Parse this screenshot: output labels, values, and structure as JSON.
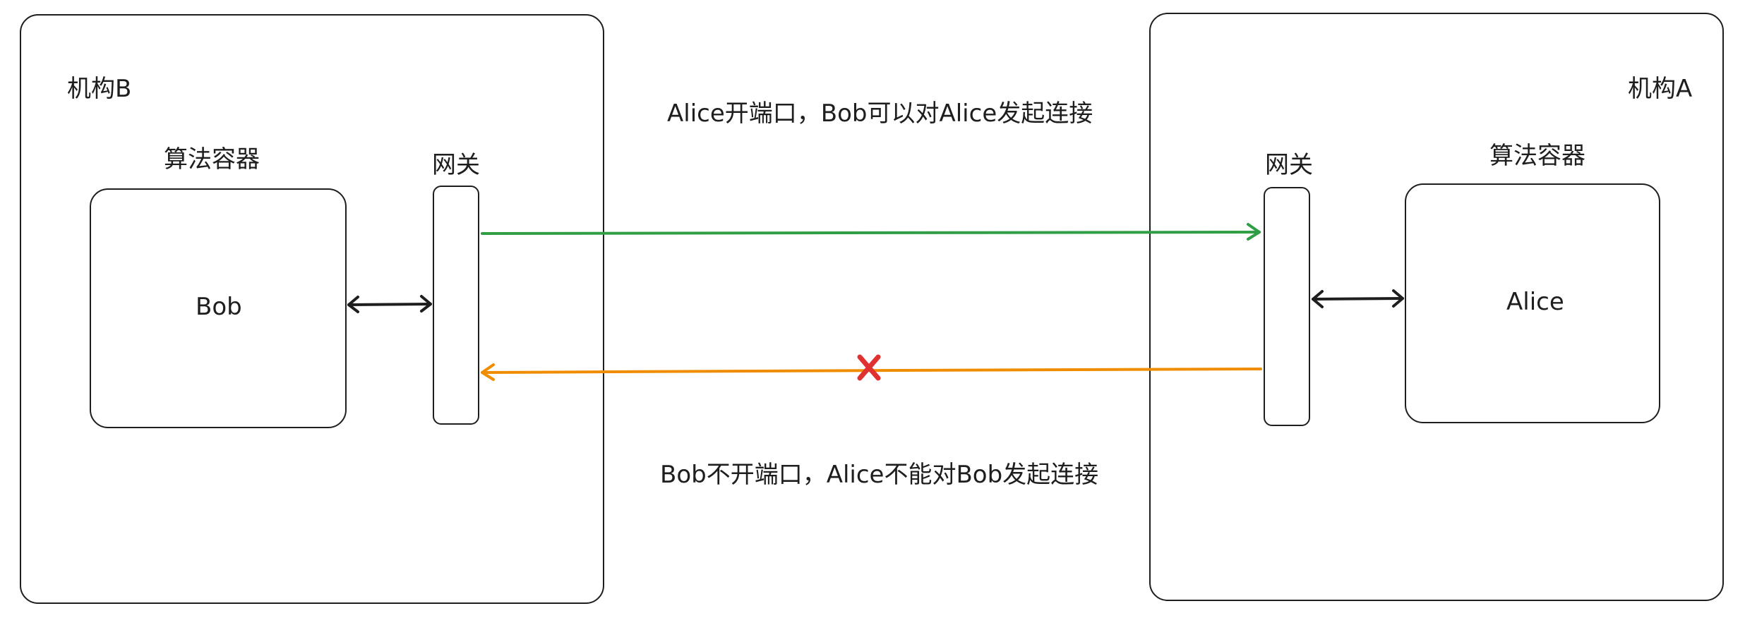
{
  "org_b": {
    "title": "机构B",
    "container_title": "算法容器",
    "gateway_title": "网关",
    "container_label": "Bob"
  },
  "org_a": {
    "title": "机构A",
    "container_title": "算法容器",
    "gateway_title": "网关",
    "container_label": "Alice"
  },
  "connections": {
    "allowed_caption": "Alice开端口，Bob可以对Alice发起连接",
    "blocked_caption": "Bob不开端口，Alice不能对Bob发起连接",
    "allowed_color": "#2f9e44",
    "blocked_color": "#f08c00",
    "blocked_marker_color": "#e03131"
  }
}
